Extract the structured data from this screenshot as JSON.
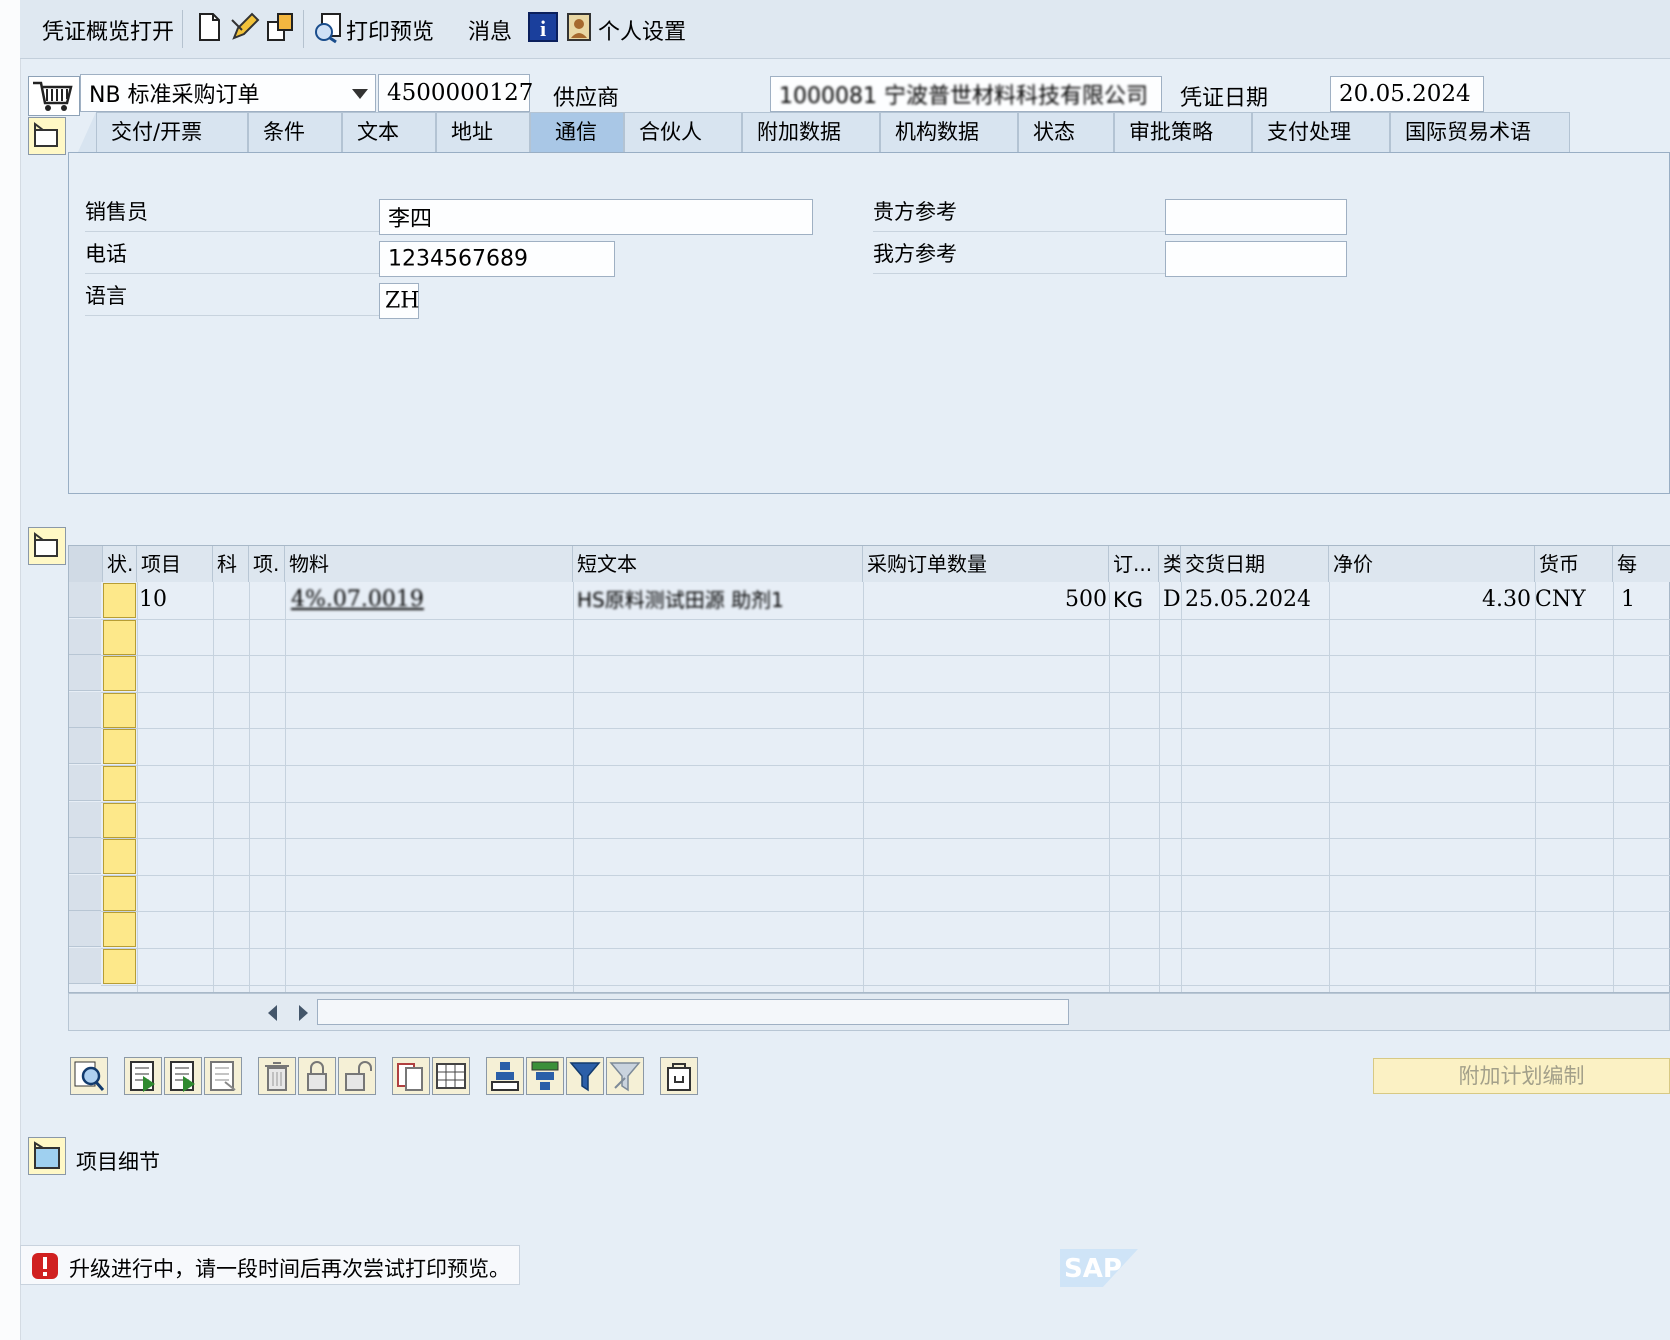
{
  "toolbar": {
    "doc_overview": "凭证概览打开",
    "print_preview": "打印预览",
    "messages": "消息",
    "personal_settings": "个人设置"
  },
  "header": {
    "doc_type": "NB 标准采购订单",
    "po_number": "4500000127",
    "vendor_label": "供应商",
    "vendor_value": "1000081 宁波普世材料科技有限公司",
    "doc_date_label": "凭证日期",
    "doc_date": "20.05.2024"
  },
  "tabs": [
    {
      "label": "交付/开票"
    },
    {
      "label": "条件"
    },
    {
      "label": "文本"
    },
    {
      "label": "地址"
    },
    {
      "label": "通信",
      "active": true
    },
    {
      "label": "合伙人"
    },
    {
      "label": "附加数据"
    },
    {
      "label": "机构数据"
    },
    {
      "label": "状态"
    },
    {
      "label": "审批策略"
    },
    {
      "label": "支付处理"
    },
    {
      "label": "国际贸易术语"
    }
  ],
  "comm": {
    "salesperson_label": "销售员",
    "salesperson": "李四",
    "phone_label": "电话",
    "phone": "1234567689",
    "language_label": "语言",
    "language": "ZH",
    "your_ref_label": "贵方参考",
    "your_ref": "",
    "our_ref_label": "我方参考",
    "our_ref": ""
  },
  "items": {
    "columns": [
      "状.",
      "项目",
      "科",
      "项.",
      "物料",
      "短文本",
      "采购订单数量",
      "订...",
      "类",
      "交货日期",
      "净价",
      "货币",
      "每"
    ],
    "rows": [
      {
        "item": "10",
        "material": "4%.07.0019",
        "short_text": "HS原料测试田源 助剂1",
        "qty": "500",
        "unit": "KG",
        "cat": "D",
        "delivery_date": "25.05.2024",
        "net_price": "4.30",
        "currency": "CNY",
        "per": "1"
      }
    ]
  },
  "buttons": {
    "additional_planning": "附加计划编制",
    "item_detail": "项目细节"
  },
  "status_bar": {
    "message": "升级进行中，请一段时间后再次尝试打印预览。",
    "logo": "SAP"
  },
  "colors": {
    "background": "#e6eef6",
    "tab_active": "#a9c7e6",
    "status_cell": "#fde88a",
    "error_red": "#d02020"
  }
}
